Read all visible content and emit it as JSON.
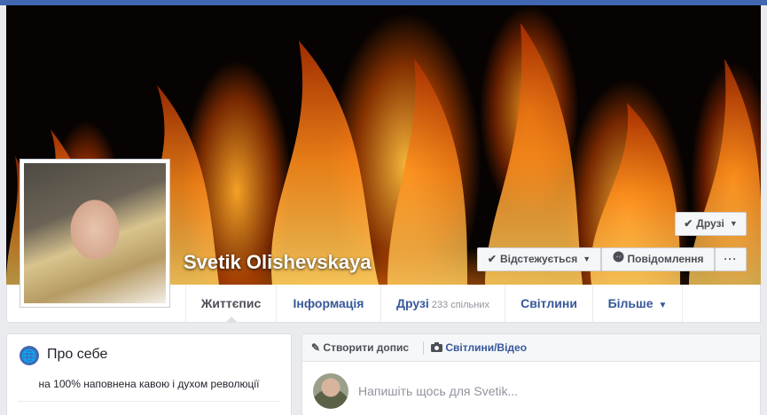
{
  "profile": {
    "name": "Svetik Olishevskaya"
  },
  "actions": {
    "friends_label": "Друзі",
    "follow_label": "Відстежується",
    "message_label": "Повідомлення",
    "more_label": "···"
  },
  "tabs": {
    "timeline": "Життєпис",
    "about": "Інформація",
    "friends": "Друзі",
    "friends_sub": "233 спільних",
    "photos": "Світлини",
    "more": "Більше"
  },
  "intro": {
    "title": "Про себе",
    "bio": "на 100% наповнена кавою і духом революції"
  },
  "composer": {
    "create_label": "Створити допис",
    "media_label": "Світлини/Відео",
    "placeholder": "Напишіть щось для Svetik..."
  },
  "colors": {
    "brand": "#4267b2",
    "link": "#365899",
    "background": "#e9ebee"
  }
}
